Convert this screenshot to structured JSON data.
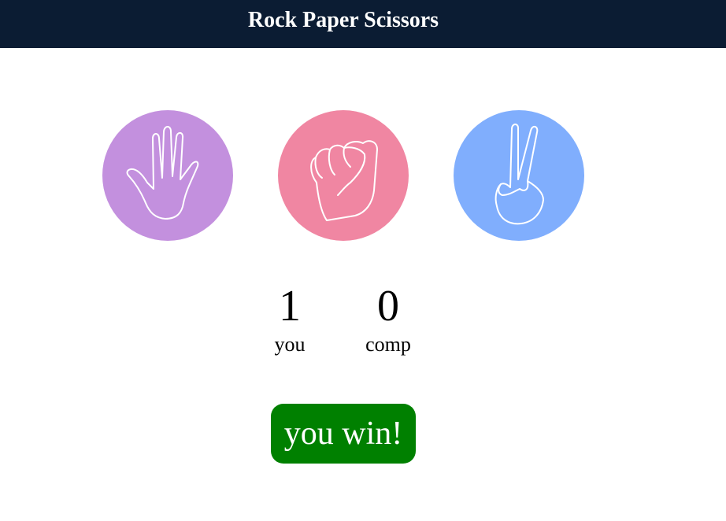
{
  "header": {
    "title": "Rock Paper Scissors"
  },
  "choices": [
    {
      "name": "paper",
      "icon": "open-hand-icon",
      "color": "#c390de"
    },
    {
      "name": "rock",
      "icon": "fist-icon",
      "color": "#f086a2"
    },
    {
      "name": "scissors",
      "icon": "peace-hand-icon",
      "color": "#80aefd"
    }
  ],
  "score": {
    "user": {
      "value": "1",
      "label": "you"
    },
    "computer": {
      "value": "0",
      "label": "comp"
    }
  },
  "result": {
    "text": "you win!",
    "color": "#008000"
  },
  "colors": {
    "header_bg": "#0b1c33"
  }
}
